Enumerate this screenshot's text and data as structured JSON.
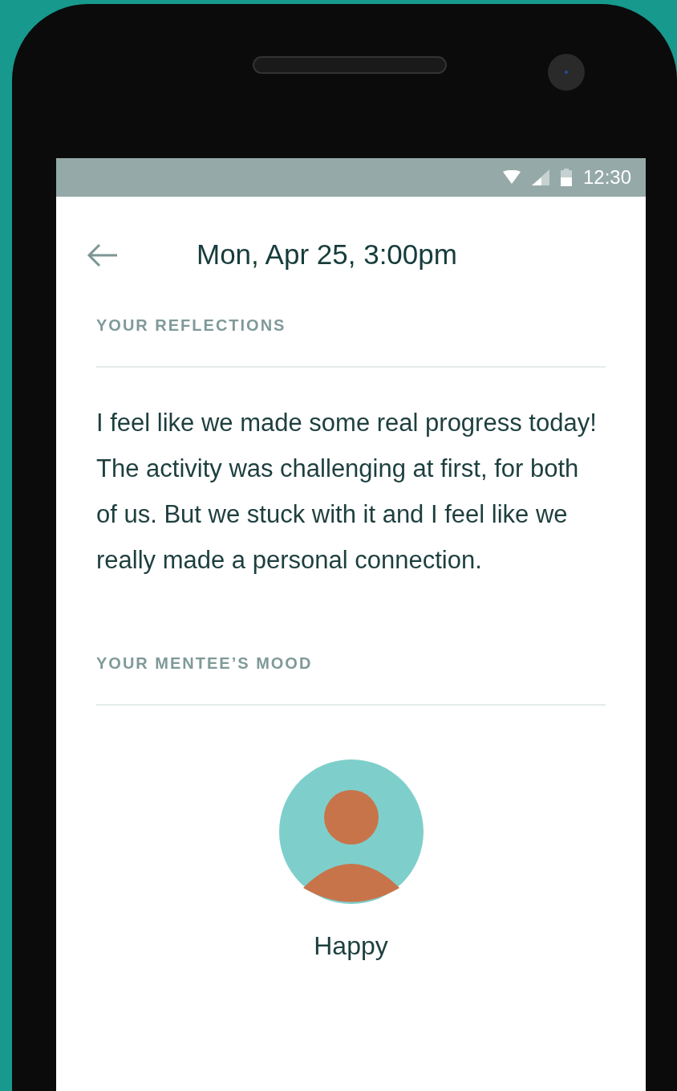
{
  "status_bar": {
    "time": "12:30"
  },
  "header": {
    "title": "Mon, Apr 25, 3:00pm"
  },
  "sections": [
    {
      "kind": "text",
      "heading": "YOUR REFLECTIONS",
      "body": "I feel like we made some real progress today! The activity was challenging at first, for both of us. But we stuck with it and I feel like we really made a personal connection."
    },
    {
      "kind": "mood",
      "heading": "YOUR MENTEE’S MOOD",
      "mood": "Happy"
    }
  ]
}
